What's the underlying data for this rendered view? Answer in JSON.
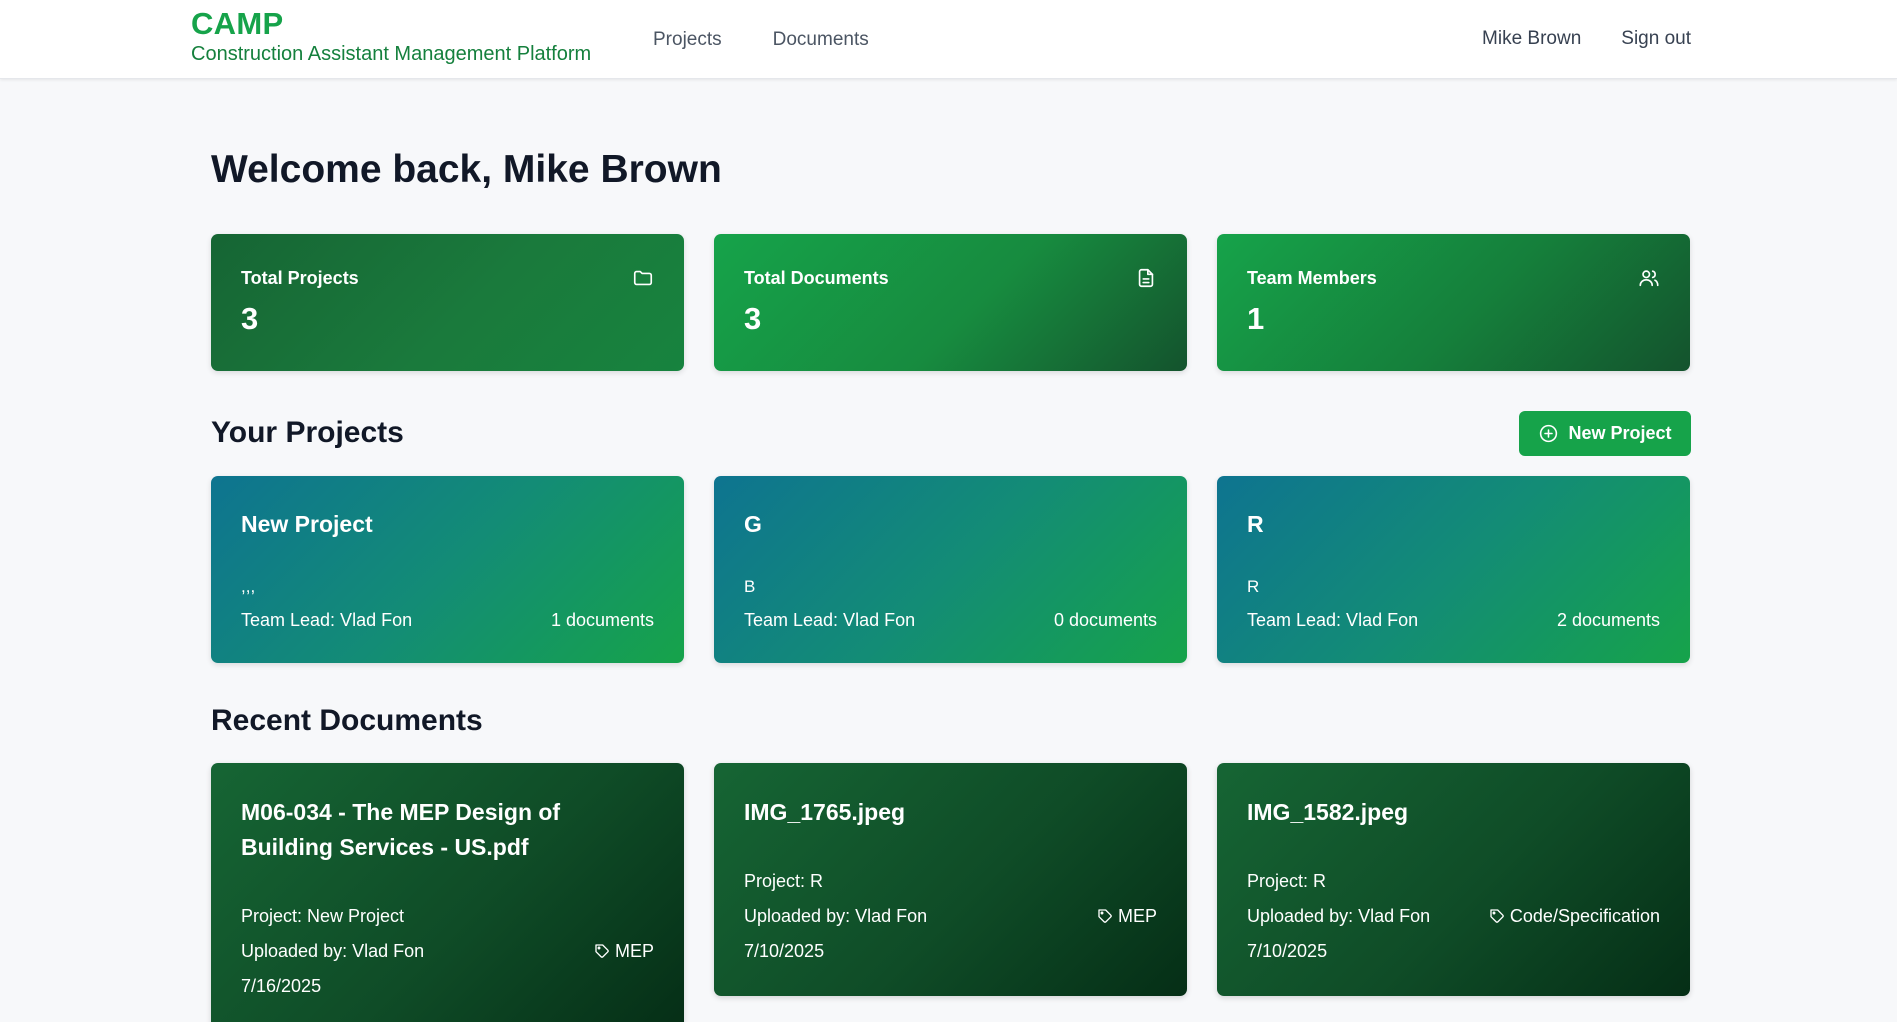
{
  "header": {
    "brand": "CAMP",
    "tagline": "Construction Assistant Management Platform",
    "nav": [
      {
        "label": "Projects"
      },
      {
        "label": "Documents"
      }
    ],
    "user_name": "Mike Brown",
    "sign_out": "Sign out"
  },
  "welcome": "Welcome back, Mike Brown",
  "stats": [
    {
      "label": "Total Projects",
      "value": "3",
      "icon": "folder-icon"
    },
    {
      "label": "Total Documents",
      "value": "3",
      "icon": "document-icon"
    },
    {
      "label": "Team Members",
      "value": "1",
      "icon": "users-icon"
    }
  ],
  "projects_section": {
    "title": "Your Projects",
    "new_button": "New Project",
    "items": [
      {
        "name": "New Project",
        "description": ",,,",
        "lead": "Team Lead: Vlad Fon",
        "docs": "1 documents"
      },
      {
        "name": "G",
        "description": "B",
        "lead": "Team Lead: Vlad Fon",
        "docs": "0 documents"
      },
      {
        "name": "R",
        "description": "R",
        "lead": "Team Lead: Vlad Fon",
        "docs": "2 documents"
      }
    ]
  },
  "documents_section": {
    "title": "Recent Documents",
    "items": [
      {
        "name": "M06-034 - The MEP Design of Building Services - US.pdf",
        "project": "Project: New Project",
        "uploaded_by": "Uploaded by: Vlad Fon",
        "tag": "MEP",
        "date": "7/16/2025"
      },
      {
        "name": "IMG_1765.jpeg",
        "project": "Project: R",
        "uploaded_by": "Uploaded by: Vlad Fon",
        "tag": "MEP",
        "date": "7/10/2025"
      },
      {
        "name": "IMG_1582.jpeg",
        "project": "Project: R",
        "uploaded_by": "Uploaded by: Vlad Fon",
        "tag": "Code/Specification",
        "date": "7/10/2025"
      }
    ]
  },
  "colors": {
    "brand_green": "#16a34a",
    "dark_green": "#14532d",
    "teal": "#0e7490",
    "background": "#f7f8fa"
  }
}
